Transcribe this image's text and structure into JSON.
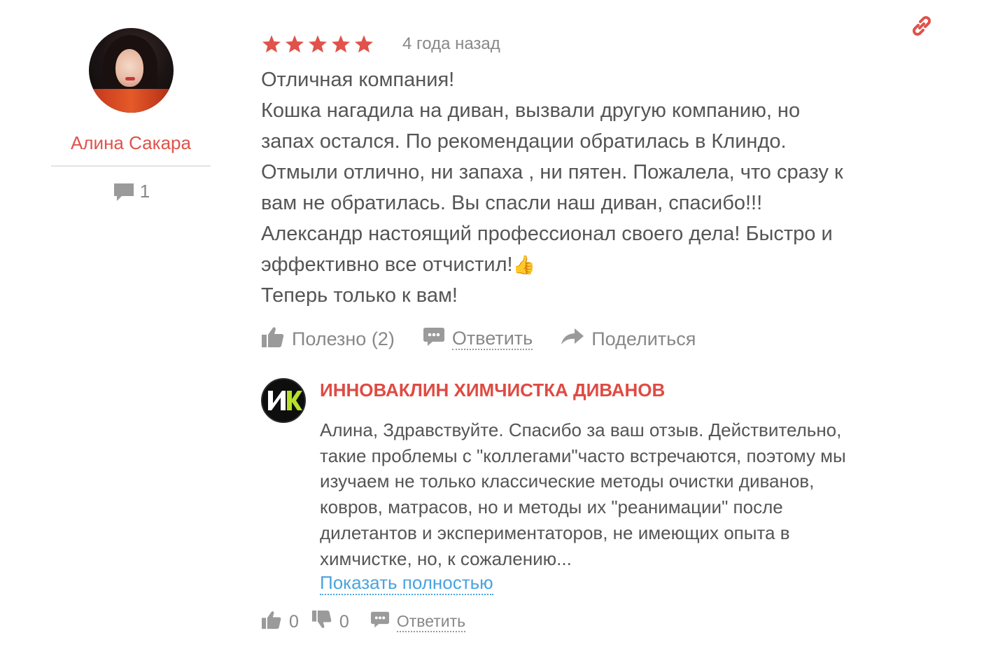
{
  "author": {
    "name": "Алина Сакара",
    "comments_count": "1"
  },
  "review": {
    "stars": 5,
    "star_color": "#e0524a",
    "date": "4 года назад",
    "text_lines": [
      "Отличная компания!",
      "Кошка нагадила на диван, вызвали другую компанию, но",
      "запах остался. По рекомендации обратилась в Клиндо.",
      "Отмыли отлично, ни запаха , ни пятен. Пожалела, что сразу к",
      "вам не обратилась. Вы спасли наш диван, спасибо!!!",
      "Александр настоящий профессионал своего дела! Быстро и",
      "эффективно все отчистил!",
      "Теперь только к вам!"
    ],
    "emoji": "👍",
    "actions": {
      "useful": "Полезно (2)",
      "reply": "Ответить",
      "share": "Поделиться"
    }
  },
  "reply": {
    "company": "ИННОВАКЛИН ХИМЧИСТКА ДИВАНОВ",
    "logo_text": "ИК",
    "text_lines": [
      "Алина, Здравствуйте. Спасибо за ваш отзыв. Действительно,",
      "такие проблемы с \"коллегами\"часто встречаются, поэтому мы",
      "изучаем не только классические методы очистки диванов,",
      "ковров, матрасов, но и методы их \"реанимации\" после",
      "дилетантов и экспериментаторов, не имеющих опыта в",
      "химчистке, но, к сожалению..."
    ],
    "show_more": "Показать полностью",
    "likes": "0",
    "dislikes": "0",
    "reply_label": "Ответить"
  },
  "colors": {
    "accent": "#e0524a",
    "link": "#4aa3df",
    "muted": "#888888",
    "text": "#555555"
  }
}
